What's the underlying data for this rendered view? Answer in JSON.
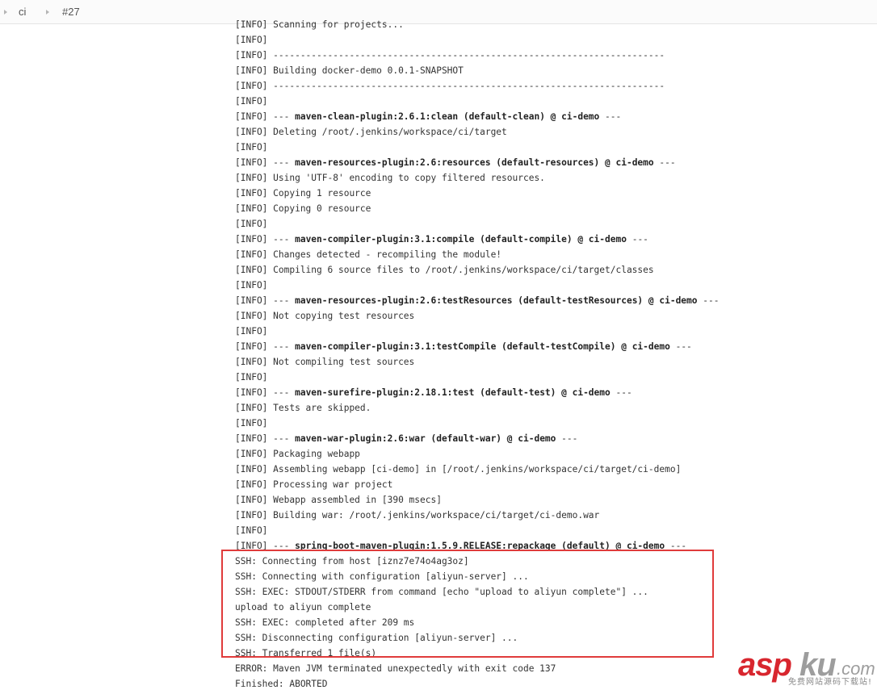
{
  "breadcrumb": {
    "items": [
      {
        "label": "ci"
      },
      {
        "label": "#27"
      }
    ]
  },
  "console": {
    "lines": [
      {
        "segments": [
          {
            "t": "[INFO] Scanning for projects..."
          }
        ]
      },
      {
        "segments": [
          {
            "t": "[INFO]"
          }
        ]
      },
      {
        "segments": [
          {
            "t": "[INFO] ------------------------------------------------------------------------"
          }
        ]
      },
      {
        "segments": [
          {
            "t": "[INFO] Building docker-demo 0.0.1-SNAPSHOT"
          }
        ]
      },
      {
        "segments": [
          {
            "t": "[INFO] ------------------------------------------------------------------------"
          }
        ]
      },
      {
        "segments": [
          {
            "t": "[INFO]"
          }
        ]
      },
      {
        "segments": [
          {
            "t": "[INFO] --- "
          },
          {
            "t": "maven-clean-plugin:2.6.1:clean (default-clean) @ ci-demo",
            "b": true
          },
          {
            "t": " ---"
          }
        ]
      },
      {
        "segments": [
          {
            "t": "[INFO] Deleting /root/.jenkins/workspace/ci/target"
          }
        ]
      },
      {
        "segments": [
          {
            "t": "[INFO]"
          }
        ]
      },
      {
        "segments": [
          {
            "t": "[INFO] --- "
          },
          {
            "t": "maven-resources-plugin:2.6:resources (default-resources) @ ci-demo",
            "b": true
          },
          {
            "t": " ---"
          }
        ]
      },
      {
        "segments": [
          {
            "t": "[INFO] Using 'UTF-8' encoding to copy filtered resources."
          }
        ]
      },
      {
        "segments": [
          {
            "t": "[INFO] Copying 1 resource"
          }
        ]
      },
      {
        "segments": [
          {
            "t": "[INFO] Copying 0 resource"
          }
        ]
      },
      {
        "segments": [
          {
            "t": "[INFO]"
          }
        ]
      },
      {
        "segments": [
          {
            "t": "[INFO] --- "
          },
          {
            "t": "maven-compiler-plugin:3.1:compile (default-compile) @ ci-demo",
            "b": true
          },
          {
            "t": " ---"
          }
        ]
      },
      {
        "segments": [
          {
            "t": "[INFO] Changes detected - recompiling the module!"
          }
        ]
      },
      {
        "segments": [
          {
            "t": "[INFO] Compiling 6 source files to /root/.jenkins/workspace/ci/target/classes"
          }
        ]
      },
      {
        "segments": [
          {
            "t": "[INFO]"
          }
        ]
      },
      {
        "segments": [
          {
            "t": "[INFO] --- "
          },
          {
            "t": "maven-resources-plugin:2.6:testResources (default-testResources) @ ci-demo",
            "b": true
          },
          {
            "t": " ---"
          }
        ]
      },
      {
        "segments": [
          {
            "t": "[INFO] Not copying test resources"
          }
        ]
      },
      {
        "segments": [
          {
            "t": "[INFO]"
          }
        ]
      },
      {
        "segments": [
          {
            "t": "[INFO] --- "
          },
          {
            "t": "maven-compiler-plugin:3.1:testCompile (default-testCompile) @ ci-demo",
            "b": true
          },
          {
            "t": " ---"
          }
        ]
      },
      {
        "segments": [
          {
            "t": "[INFO] Not compiling test sources"
          }
        ]
      },
      {
        "segments": [
          {
            "t": "[INFO]"
          }
        ]
      },
      {
        "segments": [
          {
            "t": "[INFO] --- "
          },
          {
            "t": "maven-surefire-plugin:2.18.1:test (default-test) @ ci-demo",
            "b": true
          },
          {
            "t": " ---"
          }
        ]
      },
      {
        "segments": [
          {
            "t": "[INFO] Tests are skipped."
          }
        ]
      },
      {
        "segments": [
          {
            "t": "[INFO]"
          }
        ]
      },
      {
        "segments": [
          {
            "t": "[INFO] --- "
          },
          {
            "t": "maven-war-plugin:2.6:war (default-war) @ ci-demo",
            "b": true
          },
          {
            "t": " ---"
          }
        ]
      },
      {
        "segments": [
          {
            "t": "[INFO] Packaging webapp"
          }
        ]
      },
      {
        "segments": [
          {
            "t": "[INFO] Assembling webapp [ci-demo] in [/root/.jenkins/workspace/ci/target/ci-demo]"
          }
        ]
      },
      {
        "segments": [
          {
            "t": "[INFO] Processing war project"
          }
        ]
      },
      {
        "segments": [
          {
            "t": "[INFO] Webapp assembled in [390 msecs]"
          }
        ]
      },
      {
        "segments": [
          {
            "t": "[INFO] Building war: /root/.jenkins/workspace/ci/target/ci-demo.war"
          }
        ]
      },
      {
        "segments": [
          {
            "t": "[INFO]"
          }
        ]
      },
      {
        "segments": [
          {
            "t": "[INFO] --- "
          },
          {
            "t": "spring-boot-maven-plugin:1.5.9.RELEASE:repackage (default) @ ci-demo",
            "b": true
          },
          {
            "t": " ---"
          }
        ]
      },
      {
        "segments": [
          {
            "t": "SSH: Connecting from host [iznz7e74o4ag3oz]"
          }
        ]
      },
      {
        "segments": [
          {
            "t": "SSH: Connecting with configuration [aliyun-server] ..."
          }
        ]
      },
      {
        "segments": [
          {
            "t": "SSH: EXEC: STDOUT/STDERR from command [echo \"upload to aliyun complete\"] ..."
          }
        ]
      },
      {
        "segments": [
          {
            "t": "upload to aliyun complete"
          }
        ]
      },
      {
        "segments": [
          {
            "t": "SSH: EXEC: completed after 209 ms"
          }
        ]
      },
      {
        "segments": [
          {
            "t": "SSH: Disconnecting configuration [aliyun-server] ..."
          }
        ]
      },
      {
        "segments": [
          {
            "t": "SSH: Transferred 1 file(s)"
          }
        ]
      },
      {
        "segments": [
          {
            "t": "ERROR: Maven JVM terminated unexpectedly with exit code 137"
          }
        ]
      },
      {
        "segments": [
          {
            "t": "Finished: ABORTED"
          }
        ]
      }
    ]
  },
  "highlight": {
    "color": "#e03b3b"
  },
  "watermark": {
    "brand_a": "asp",
    "brand_b": "ku",
    "brand_c": ".com",
    "tagline": "免费网站源码下载站!"
  }
}
